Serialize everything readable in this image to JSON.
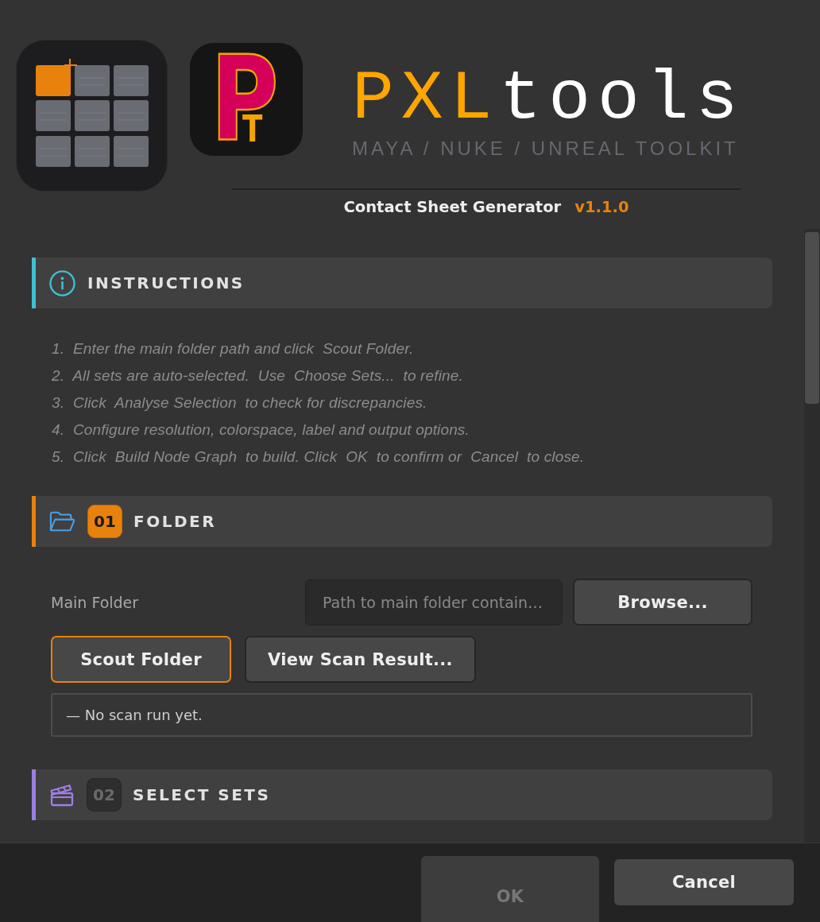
{
  "header": {
    "monogram": "P$_{T}$",
    "wordmark": {
      "accent": "PXL",
      "rest": "tools"
    },
    "tagline": "MAYA / NUKE / UNREAL TOOLKIT",
    "tool_name": "Contact Sheet Generator",
    "version": "v1.1.0"
  },
  "sections": [
    {
      "kind": "info",
      "title": "INSTRUCTIONS",
      "color": "#3ec0d4",
      "steps": [
        "1.  Enter the main folder path and click  Scout Folder.",
        "2.  All sets are auto-selected.  Use  Choose Sets...  to refine.",
        "3.  Click  Analyse Selection  to check for discrepancies.",
        "4.  Configure resolution, colorspace, label and output options.",
        "5.  Click  Build Node Graph  to build. Click  OK  to confirm or  Cancel  to close."
      ]
    },
    {
      "kind": "folder",
      "badge": {
        "text": "01",
        "active": true
      },
      "title": "FOLDER",
      "color": "#e8820c",
      "folder_label": "Main Folder",
      "path_field": {
        "placeholder": "Path to main folder contain…"
      },
      "browse_button": "Browse...",
      "buttons": [
        {
          "label": "Scout Folder",
          "focused": true
        },
        {
          "label": "View Scan Result...",
          "focused": false
        }
      ],
      "status": "— No scan run yet."
    },
    {
      "kind": "sets",
      "badge": {
        "text": "02",
        "active": false
      },
      "title": "SELECT SETS",
      "color": "#9b7fe0"
    }
  ],
  "footer": {
    "buttons": [
      {
        "label": "OK",
        "disabled": true
      },
      {
        "label": "Cancel",
        "disabled": false
      }
    ]
  }
}
